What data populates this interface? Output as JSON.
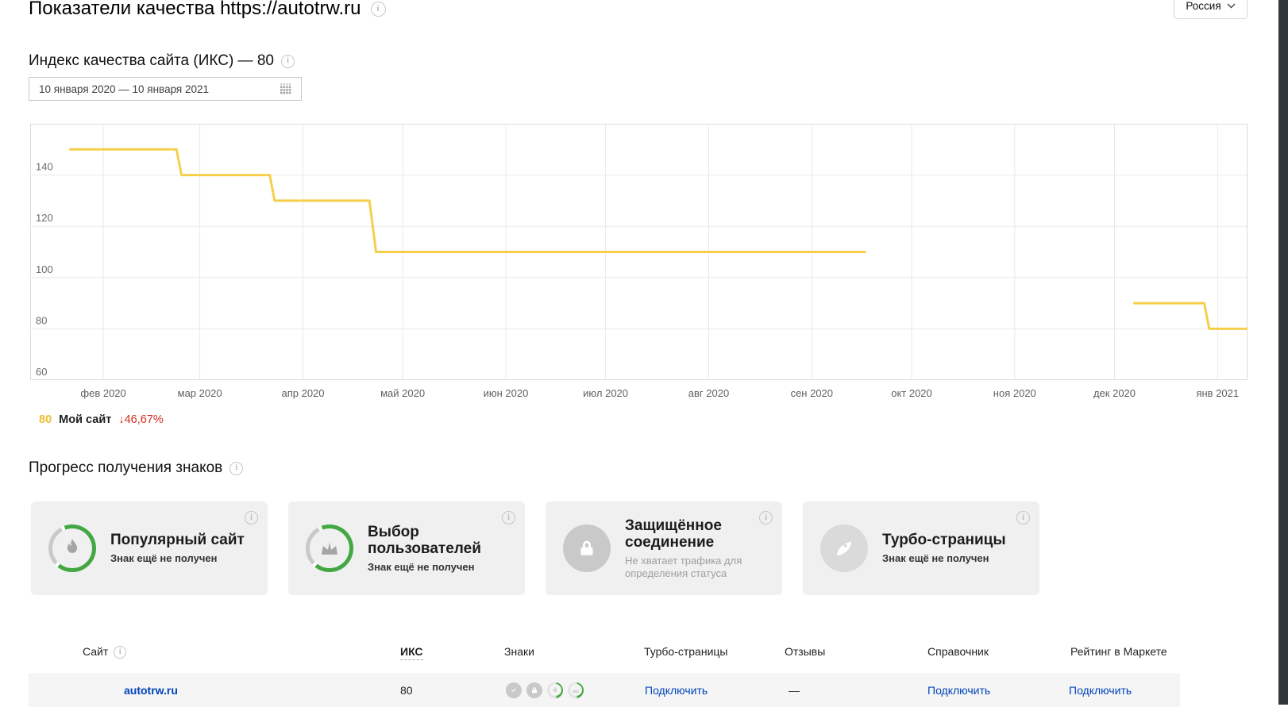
{
  "page": {
    "title": "Показатели качества https://autotrw.ru",
    "region": "Россия"
  },
  "iks": {
    "heading": "Индекс качества сайта (ИКС) — 80",
    "date_range": "10 января 2020 — 10 января 2021",
    "legend": {
      "value": "80",
      "name": "Мой сайт",
      "delta": "↓46,67%"
    }
  },
  "chart_data": {
    "type": "line",
    "x_start_label": "10 января 2020",
    "x_end_label": "10 января 2021",
    "x_total_days": 366,
    "ylim": [
      60,
      160
    ],
    "yticks": [
      60,
      80,
      100,
      120,
      140
    ],
    "grid": true,
    "legend_position": "bottom-left",
    "months": [
      {
        "label": "фев 2020",
        "day": 22
      },
      {
        "label": "мар 2020",
        "day": 51
      },
      {
        "label": "апр 2020",
        "day": 82
      },
      {
        "label": "май 2020",
        "day": 112
      },
      {
        "label": "июн 2020",
        "day": 143
      },
      {
        "label": "июл 2020",
        "day": 173
      },
      {
        "label": "авг 2020",
        "day": 204
      },
      {
        "label": "сен 2020",
        "day": 235
      },
      {
        "label": "окт 2020",
        "day": 265
      },
      {
        "label": "ноя 2020",
        "day": 296
      },
      {
        "label": "дек 2020",
        "day": 326
      },
      {
        "label": "янв 2021",
        "day": 357
      }
    ],
    "series": [
      {
        "name": "Мой сайт",
        "color": "#f5cf4a",
        "current_value": 80,
        "change_percent": -46.67,
        "segments": [
          [
            [
              12,
              150
            ],
            [
              44,
              150
            ],
            [
              45.5,
              140
            ],
            [
              72,
              140
            ],
            [
              73.5,
              130
            ],
            [
              102,
              130
            ],
            [
              104,
              110
            ],
            [
              251,
              110
            ]
          ],
          [
            [
              332,
              90
            ],
            [
              353,
              90
            ],
            [
              354.5,
              80
            ],
            [
              366,
              80
            ]
          ]
        ]
      }
    ]
  },
  "badges": {
    "heading": "Прогресс получения знаков",
    "items": [
      {
        "title": "Популярный сайт",
        "status": "Знак ещё не получен",
        "icon": "flame",
        "style": "ring",
        "muted": false
      },
      {
        "title": "Выбор пользователей",
        "status": "Знак ещё не получен",
        "icon": "crown",
        "style": "ring",
        "muted": false
      },
      {
        "title": "Защищённое соединение",
        "status": "Не хватает трафика для определения статуса",
        "icon": "lock",
        "style": "solid",
        "muted": true
      },
      {
        "title": "Турбо-страницы",
        "status": "Знак ещё не получен",
        "icon": "rocket",
        "style": "solid-light",
        "muted": false
      }
    ]
  },
  "table": {
    "headers": [
      "Сайт",
      "ИКС",
      "Знаки",
      "Турбо-страницы",
      "Отзывы",
      "Справочник",
      "Рейтинг в Маркете"
    ],
    "row": {
      "site": "autotrw.ru",
      "iks": "80",
      "signs": [
        {
          "icon": "check",
          "style": "solid"
        },
        {
          "icon": "lock",
          "style": "solid"
        },
        {
          "icon": "flame",
          "style": "ring"
        },
        {
          "icon": "crown",
          "style": "ring"
        }
      ],
      "turbo": "Подключить",
      "reviews": "—",
      "directory": "Подключить",
      "market": "Подключить"
    }
  },
  "colors": {
    "line": "#f5cf4a",
    "legend_value": "#eebf2f",
    "delta_red": "#d62c20",
    "link_blue": "#0044bb",
    "ring_green": "#43a843"
  }
}
